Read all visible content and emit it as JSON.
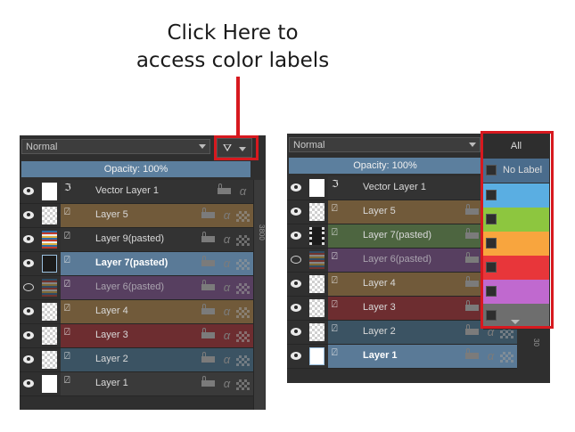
{
  "annotation": {
    "line1": "Click Here to",
    "line2": "access color labels",
    "highlight_color": "#d7191f"
  },
  "left_panel": {
    "blend_mode": "Normal",
    "filter_icon": "filter-funnel-icon",
    "opacity_label": "Opacity:  100%",
    "side_ruler_text": "3800",
    "layers": [
      {
        "name": "Vector Layer 1",
        "color": "#333333",
        "visible": true,
        "thumb": "white",
        "type": "vector",
        "style": "normal"
      },
      {
        "name": "Layer 5",
        "color": "#715a3a",
        "visible": true,
        "thumb": "checker",
        "type": "paint",
        "style": "normal"
      },
      {
        "name": "Layer 9(pasted)",
        "color": "#333333",
        "visible": true,
        "thumb": "pasted",
        "type": "paint",
        "style": "normal"
      },
      {
        "name": "Layer 7(pasted)",
        "color": "#5a7a97",
        "visible": true,
        "thumb": "film",
        "type": "paint",
        "style": "bold"
      },
      {
        "name": "Layer 6(pasted)",
        "color": "#573f60",
        "visible": false,
        "thumb": "pasted",
        "type": "paint",
        "style": "faded"
      },
      {
        "name": "Layer 4",
        "color": "#715a3a",
        "visible": true,
        "thumb": "checker",
        "type": "paint",
        "style": "normal"
      },
      {
        "name": "Layer 3",
        "color": "#6d2d30",
        "visible": true,
        "thumb": "checker",
        "type": "paint",
        "style": "normal"
      },
      {
        "name": "Layer 2",
        "color": "#3b5363",
        "visible": true,
        "thumb": "checker",
        "type": "paint",
        "style": "normal"
      },
      {
        "name": "Layer 1",
        "color": "#3a3a3a",
        "visible": true,
        "thumb": "white",
        "type": "paint",
        "style": "normal"
      }
    ]
  },
  "right_panel": {
    "blend_mode": "Normal",
    "opacity_label": "Opacity:  100%",
    "side_ruler_text": "30",
    "layers": [
      {
        "name": "Vector Layer 1",
        "color": "#333333",
        "visible": true,
        "thumb": "white",
        "type": "vector",
        "style": "normal"
      },
      {
        "name": "Layer 5",
        "color": "#715a3a",
        "visible": true,
        "thumb": "checker",
        "type": "paint",
        "style": "normal"
      },
      {
        "name": "Layer 7(pasted)",
        "color": "#4d6540",
        "visible": true,
        "thumb": "film",
        "type": "paint",
        "style": "normal"
      },
      {
        "name": "Layer 6(pasted)",
        "color": "#573f60",
        "visible": false,
        "thumb": "pasted",
        "type": "paint",
        "style": "faded"
      },
      {
        "name": "Layer 4",
        "color": "#715a3a",
        "visible": true,
        "thumb": "checker",
        "type": "paint",
        "style": "normal"
      },
      {
        "name": "Layer 3",
        "color": "#6d2d30",
        "visible": true,
        "thumb": "checker",
        "type": "paint",
        "style": "normal"
      },
      {
        "name": "Layer 2",
        "color": "#3b5363",
        "visible": true,
        "thumb": "checker",
        "type": "paint",
        "style": "normal"
      },
      {
        "name": "Layer 1",
        "color": "#5a7a97",
        "visible": true,
        "thumb": "white",
        "type": "paint",
        "style": "bold"
      }
    ]
  },
  "color_label_menu": {
    "all_label": "All",
    "no_label": "No Label",
    "swatches": [
      "#5aaee2",
      "#8dc63f",
      "#f8a53e",
      "#e8363a",
      "#c069cf",
      "#6e6e6e"
    ]
  }
}
